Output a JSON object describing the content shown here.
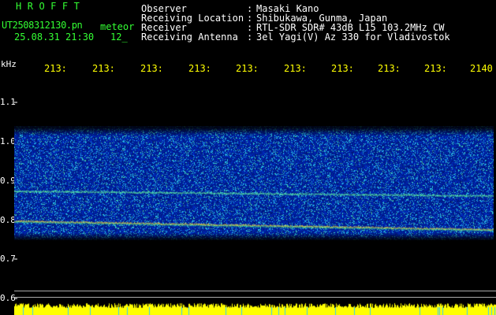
{
  "header": {
    "app_title": "HROFFT",
    "file_name": "UT2508312130.pn",
    "meteor_label": "meteor",
    "date_time": "25.08.31 21:30",
    "hour_value": "12_"
  },
  "info": [
    {
      "label": "Observer",
      "value": "Masaki Kano"
    },
    {
      "label": "Receiving Location",
      "value": "Shibukawa, Gunma, Japan"
    },
    {
      "label": "Receiver",
      "value": "RTL-SDR SDR# 43dB L15 103.2MHz CW"
    },
    {
      "label": "Receiving Antenna",
      "value": "3el Yagi(V) Az 330 for Vladivostok"
    }
  ],
  "info_colon": ":",
  "y_axis": {
    "unit_label": "kHz",
    "ticks": [
      "1.1",
      "1.0",
      "0.9",
      "0.8",
      "0.7",
      "0.6"
    ]
  },
  "x_axis": {
    "ticks": [
      "213:",
      "213:",
      "213:",
      "213:",
      "213:",
      "213:",
      "213:",
      "213:",
      "213:",
      "2140"
    ]
  },
  "colors": {
    "background": "#000000",
    "title_green": "#33ff33",
    "text_white": "#ffffff",
    "tick_yellow": "#ffff00",
    "spectrogram_base": "#1a3cc8",
    "echo_line": "#ffcc33"
  }
}
